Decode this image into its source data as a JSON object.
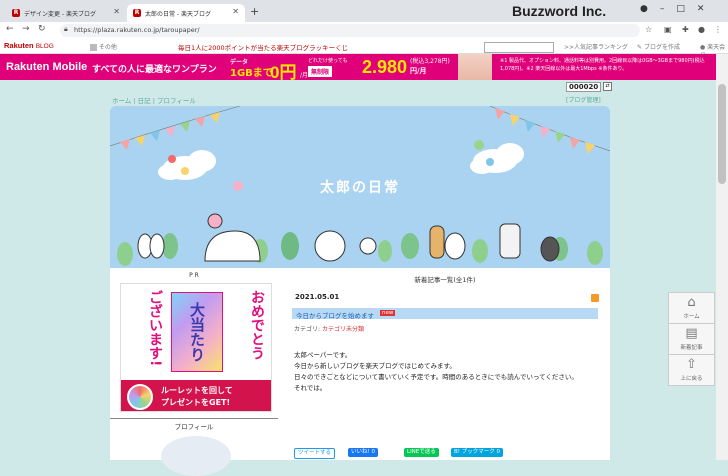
{
  "browser": {
    "tabs": [
      {
        "label": "デザイン変更 - 楽天ブログ",
        "favicon": "R"
      },
      {
        "label": "太郎の日常 - 楽天ブログ",
        "favicon": "R"
      }
    ],
    "new_tab": "+",
    "url": "https://plaza.rakuten.co.jp/taroupaper/",
    "overlay_brand": "Buzzword Inc.",
    "icons": [
      "back-icon",
      "forward-icon",
      "reload-icon",
      "lock-icon",
      "star-icon",
      "extension-icon",
      "profile-icon",
      "menu-icon"
    ]
  },
  "topbar": {
    "logo": "Rakuten",
    "logo_sub": "BLOG",
    "other": "その他",
    "promo": "毎日1人に2000ポイントが当たる楽天ブログラッキーくじ",
    "ranking": ">>人気記事ランキング",
    "create": "ブログを作成",
    "login": "楽天会員"
  },
  "ad": {
    "brand": "Rakuten Mobile",
    "message": "すべての人に最適なワンプラン",
    "data_label": "データ",
    "data_amount": "1GBまで",
    "zero_price": "0円",
    "zero_unit": "/月",
    "unlimited_note": "どれだけ使っても",
    "free_badge": "無制限",
    "price": "2.980",
    "price_unit": "円/月",
    "tax_note": "(税込3,278円)",
    "notes": [
      "※1 製品代、オプション料、通話料等は別費用。2回線目以降は0GB～3GBまで980円(税込",
      "1,078円)。※2 楽天回線以外は最大1Mbps ※条件あり。"
    ]
  },
  "blog": {
    "crumbs": [
      "ホーム",
      "日記",
      "プロフィール"
    ],
    "counter": "000020",
    "manage": "[ブログ管理]",
    "title": "太郎の日常"
  },
  "sidebar": {
    "pr_label": "P R",
    "ad_text_1": "おめでとう",
    "ad_text_2": "ございます!",
    "ad_center": "大当たり",
    "ad_button_1": "ルーレットを回して",
    "ad_button_2": "プレゼントをGET!",
    "profile": "プロフィール"
  },
  "main": {
    "heading": "新着記事一覧(全1件)",
    "date": "2021.05.01",
    "post_title": "今日からブログを始めます",
    "badge": "new",
    "category_label": "カテゴリ:",
    "category": "カテゴリ未分類",
    "body": [
      "太郎ペーパーです。",
      "今日から新しいブログを楽天ブログではじめてみます。",
      "日々のできごとなどについて書いていく予定です。時間のあるときにでも読んでいってください。",
      "それでは。"
    ],
    "share": {
      "tweet": "ツイートする",
      "like": "いいね! 0",
      "line": "LINEで送る",
      "hatena": "B! ブックマーク 0"
    }
  },
  "floating_nav": [
    {
      "label": "ホーム",
      "icon": "home-icon"
    },
    {
      "label": "新着記事",
      "icon": "document-icon"
    },
    {
      "label": "上に戻る",
      "icon": "arrow-up-icon"
    }
  ],
  "colors": {
    "accent_red": "#bf0000",
    "ad_pink": "#e0007a",
    "header_sky": "#a9d3f0",
    "page_bg": "#cfe9e9"
  }
}
